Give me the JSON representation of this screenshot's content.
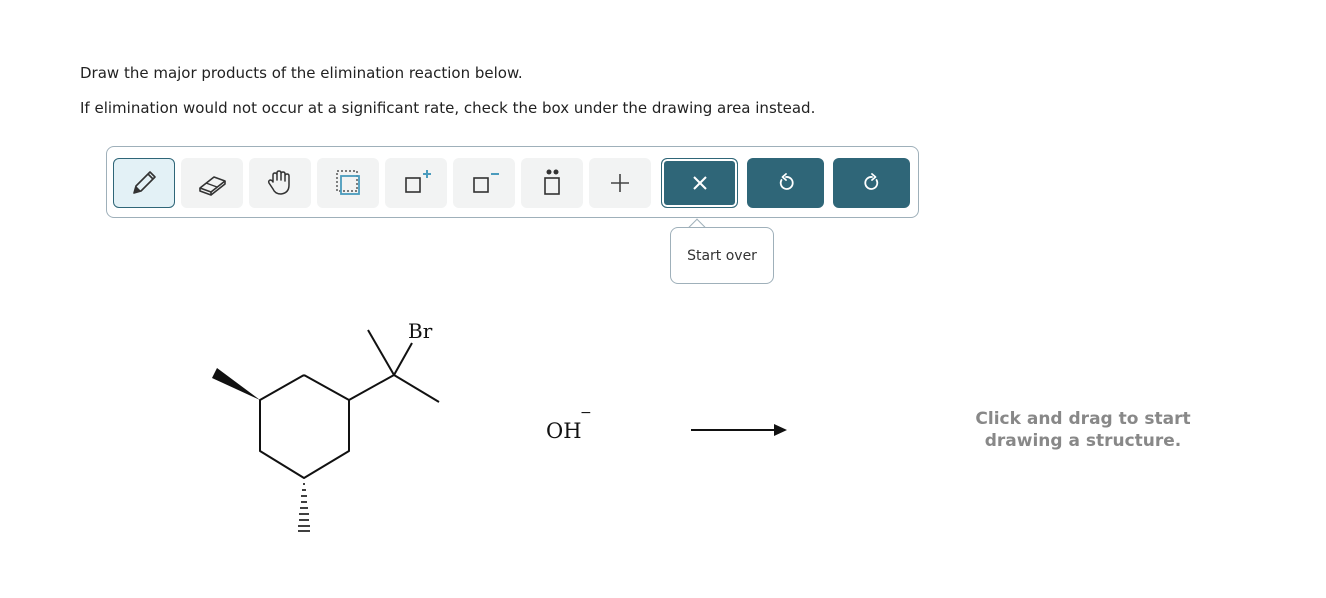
{
  "instructions": {
    "line1": "Draw the major products of the elimination reaction below.",
    "line2": "If elimination would not occur at a significant rate, check the box under the drawing area instead."
  },
  "toolbar": {
    "tools": [
      {
        "name": "pencil-icon",
        "active": true
      },
      {
        "name": "eraser-icon"
      },
      {
        "name": "hand-icon"
      },
      {
        "name": "select-box-icon"
      },
      {
        "name": "add-positive-charge-icon"
      },
      {
        "name": "add-negative-charge-icon"
      },
      {
        "name": "add-lone-pair-icon"
      },
      {
        "name": "add-plus-sign-icon"
      },
      {
        "name": "start-over-icon"
      },
      {
        "name": "undo-icon"
      },
      {
        "name": "redo-icon"
      }
    ],
    "tooltip": "Start over"
  },
  "reaction": {
    "substituent_label": "Br",
    "reagent": "OH",
    "reagent_charge": "−"
  },
  "placeholder": {
    "line1": "Click and drag to start",
    "line2": "drawing a structure."
  },
  "colors": {
    "accent": "#2f6678",
    "active_bg": "#e3f1f6",
    "tool_bg": "#f2f3f3",
    "placeholder_text": "#888888",
    "icon_blue": "#4a9bbd"
  }
}
